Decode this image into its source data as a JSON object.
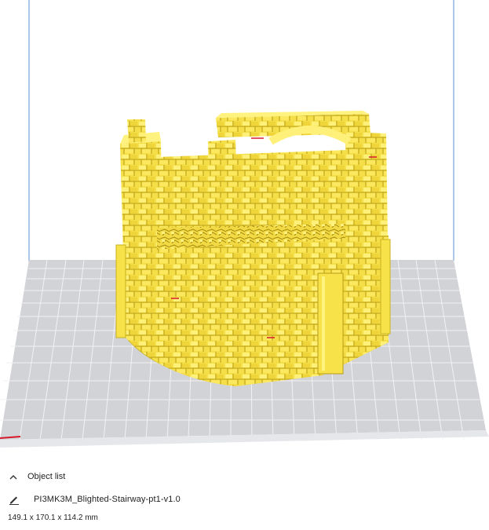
{
  "object_list": {
    "toggle_label": "Object list",
    "toggle_icon": "chevron-up-icon",
    "edit_icon": "pencil-icon",
    "object_name": "PI3MK3M_Blighted-Stairway-pt1-v1.0",
    "dimensions": "149.1 x 170.1 x 114.2 mm"
  },
  "colors": {
    "build_volume_lines": "#5b8fd6",
    "build_plate": "#d2d3d6",
    "build_plate_grid": "#f2f2f4",
    "model": "#f7e24a",
    "model_shadow": "#c9b21f",
    "axis_x": "#d8192a"
  }
}
